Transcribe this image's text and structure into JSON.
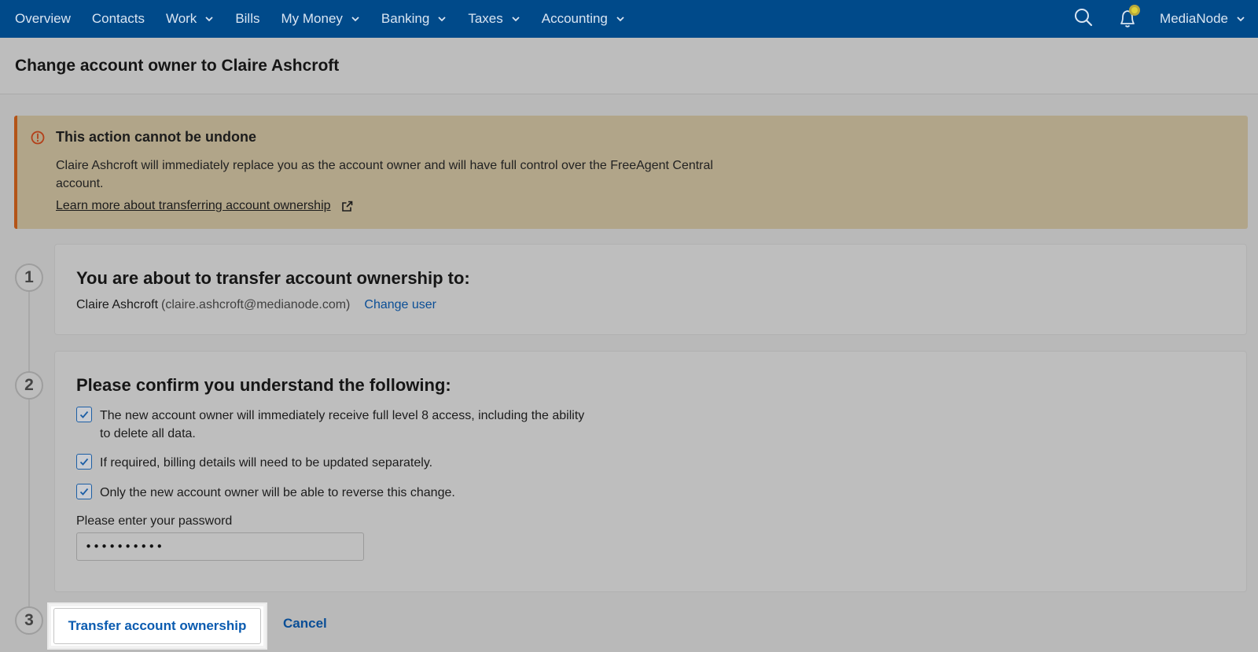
{
  "nav": {
    "items": [
      {
        "label": "Overview",
        "dropdown": false
      },
      {
        "label": "Contacts",
        "dropdown": false
      },
      {
        "label": "Work",
        "dropdown": true
      },
      {
        "label": "Bills",
        "dropdown": false
      },
      {
        "label": "My Money",
        "dropdown": true
      },
      {
        "label": "Banking",
        "dropdown": true
      },
      {
        "label": "Taxes",
        "dropdown": true
      },
      {
        "label": "Accounting",
        "dropdown": true
      }
    ],
    "org_name": "MediaNode",
    "icons": [
      "search-icon",
      "bell-icon",
      "chevron-down-icon"
    ]
  },
  "page": {
    "title": "Change account owner to Claire Ashcroft"
  },
  "alert": {
    "title": "This action cannot be undone",
    "text": "Claire Ashcroft will immediately replace you as the account owner and will have full control over the FreeAgent Central account.",
    "link": "Learn more about transferring account ownership"
  },
  "steps": {
    "one": {
      "number": "1",
      "heading": "You are about to transfer account ownership to:",
      "user_name": "Claire Ashcroft",
      "user_email": "(claire.ashcroft@medianode.com)",
      "change_link": "Change user"
    },
    "two": {
      "number": "2",
      "heading": "Please confirm you understand the following:",
      "checks": [
        {
          "text": "The new account owner will immediately receive full level 8 access, including the ability to delete all data.",
          "checked": true
        },
        {
          "text": "If required, billing details will need to be updated separately.",
          "checked": true
        },
        {
          "text": "Only the new account owner will be able to reverse this change.",
          "checked": true
        }
      ],
      "password_label": "Please enter your password",
      "password_value": "••••••••••"
    },
    "three": {
      "number": "3",
      "submit_label": "Transfer account ownership",
      "cancel_label": "Cancel"
    }
  },
  "colors": {
    "nav_bg": "#004a8a",
    "warning_bg": "#b1a589",
    "warning_accent": "#b35418",
    "link": "#0a4e96"
  }
}
